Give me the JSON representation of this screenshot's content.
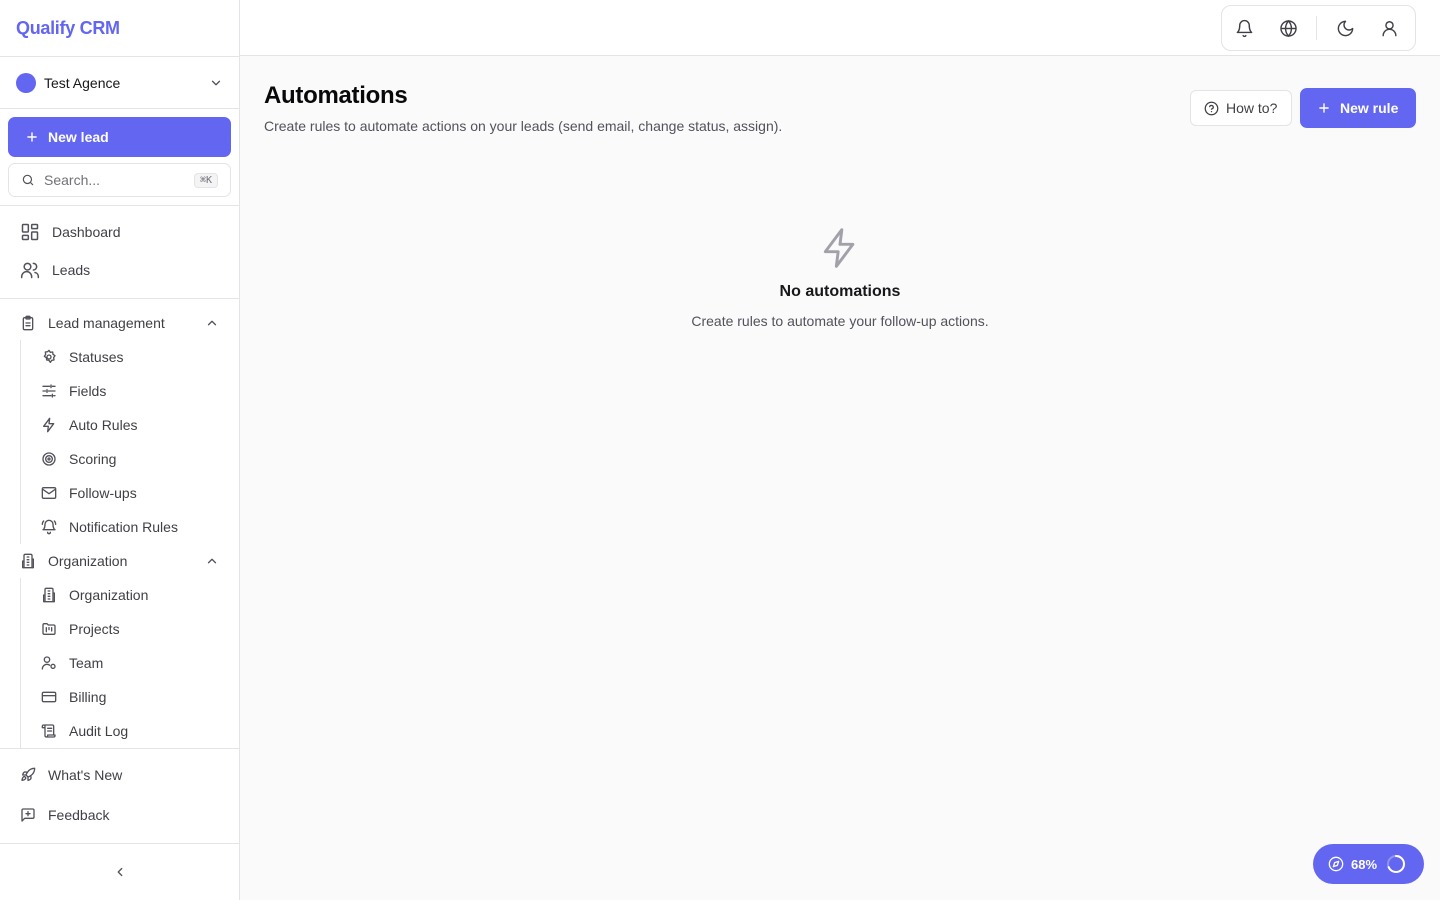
{
  "app": {
    "brand": "Qualify CRM"
  },
  "workspace": {
    "name": "Test Agence",
    "color": "#6366f1"
  },
  "sidebar": {
    "new_lead_label": "New lead",
    "search": {
      "placeholder": "Search...",
      "shortcut": "⌘K"
    },
    "primary": [
      {
        "label": "Dashboard",
        "icon": "dashboard-icon"
      },
      {
        "label": "Leads",
        "icon": "users-icon"
      }
    ],
    "groups": [
      {
        "label": "Lead management",
        "icon": "clipboard-icon",
        "expanded": true,
        "items": [
          {
            "label": "Statuses",
            "icon": "settings-icon"
          },
          {
            "label": "Fields",
            "icon": "sliders-icon"
          },
          {
            "label": "Auto Rules",
            "icon": "zap-icon"
          },
          {
            "label": "Scoring",
            "icon": "target-icon"
          },
          {
            "label": "Follow-ups",
            "icon": "mail-icon"
          },
          {
            "label": "Notification Rules",
            "icon": "bell-ring-icon"
          }
        ]
      },
      {
        "label": "Organization",
        "icon": "building-icon",
        "expanded": true,
        "items": [
          {
            "label": "Organization",
            "icon": "building-icon"
          },
          {
            "label": "Projects",
            "icon": "folder-kanban-icon"
          },
          {
            "label": "Team",
            "icon": "user-cog-icon"
          },
          {
            "label": "Billing",
            "icon": "credit-card-icon"
          },
          {
            "label": "Audit Log",
            "icon": "scroll-icon"
          }
        ]
      }
    ],
    "footer": [
      {
        "label": "What's New",
        "icon": "rocket-icon"
      },
      {
        "label": "Feedback",
        "icon": "message-square-plus-icon"
      }
    ]
  },
  "topbar": {
    "icons": [
      "bell-icon",
      "globe-icon",
      "moon-icon",
      "user-icon"
    ]
  },
  "main": {
    "title": "Automations",
    "subtitle": "Create rules to automate actions on your leads (send email, change status, assign).",
    "how_to_label": "How to?",
    "new_rule_label": "New rule",
    "empty": {
      "icon": "zap-icon",
      "title": "No automations",
      "subtitle": "Create rules to automate your follow-up actions."
    }
  },
  "progress_widget": {
    "value_label": "68%",
    "value": 0.68
  },
  "colors": {
    "accent": "#6366f1",
    "border": "#e4e4e7",
    "background": "#fafafa"
  }
}
